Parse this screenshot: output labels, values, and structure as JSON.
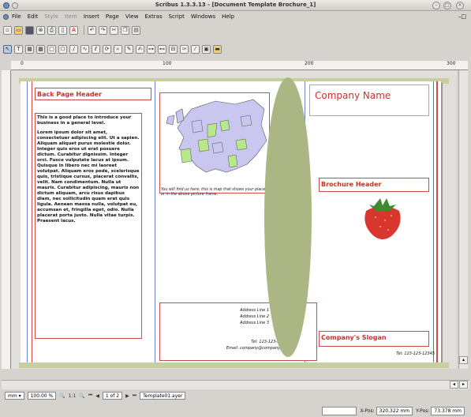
{
  "window": {
    "title": "Scribus 1.3.3.13 - [Document Template Brochure_1]"
  },
  "menu": {
    "items": [
      "File",
      "Edit",
      "Style",
      "Item",
      "Insert",
      "Page",
      "View",
      "Extras",
      "Script",
      "Windows",
      "Help"
    ],
    "disabled": [
      "Style",
      "Item"
    ]
  },
  "ruler": {
    "marks": [
      "0",
      "100",
      "200",
      "300"
    ]
  },
  "document": {
    "back_page_header": "Back Page Header",
    "intro": "This is a good place to introduce your business in a general level.",
    "body": "Lorem ipsum dolor sit amet, consectetuer adipiscing elit. Ut a sapien. Aliquam aliquet purus molestie dolor. Integer quis eros ut erat posuere dictum. Curabitur dignissim. Integer orci. Fusce vulputate lacus at ipsum. Quisque in libero nec mi laoreet volutpat. Aliquam eros pede, scelerisque quis, tristique cursus, placerat convallis, velit. Nam condimentum. Nulla ut mauris. Curabitur adipiscing, mauris non dictum aliquam, arcu risus dapibus diam, nec sollicitudin quam erat quis ligula. Aenean massa nulla, volutpat eu, accumsan et, fringilla eget, odio. Nulla placerat porta justo. Nulla vitae turpis. Praesent lacus.",
    "map_caption": "You will find us here: this is map that shows your place or in the above picture frame.",
    "address_lines": [
      "Address Line 1",
      "Address Line 2",
      "Address Line 3"
    ],
    "tel": "Tel: 123-123-12345",
    "email": "Email: company@company.com",
    "company_name": "Company Name",
    "brochure_header": "Brochure Header",
    "slogan": "Company's Slogan",
    "tel_right": "Tel: 123-123-12345"
  },
  "bottom": {
    "zoom": "100.00 %",
    "ratio": "1:1",
    "page": "1 of 2",
    "layer": "Template01.ayer"
  },
  "status": {
    "xpos_label": "X-Pos:",
    "xpos": "320.322 mm",
    "ypos_label": "Y-Pos:",
    "ypos": "73.378 mm"
  }
}
